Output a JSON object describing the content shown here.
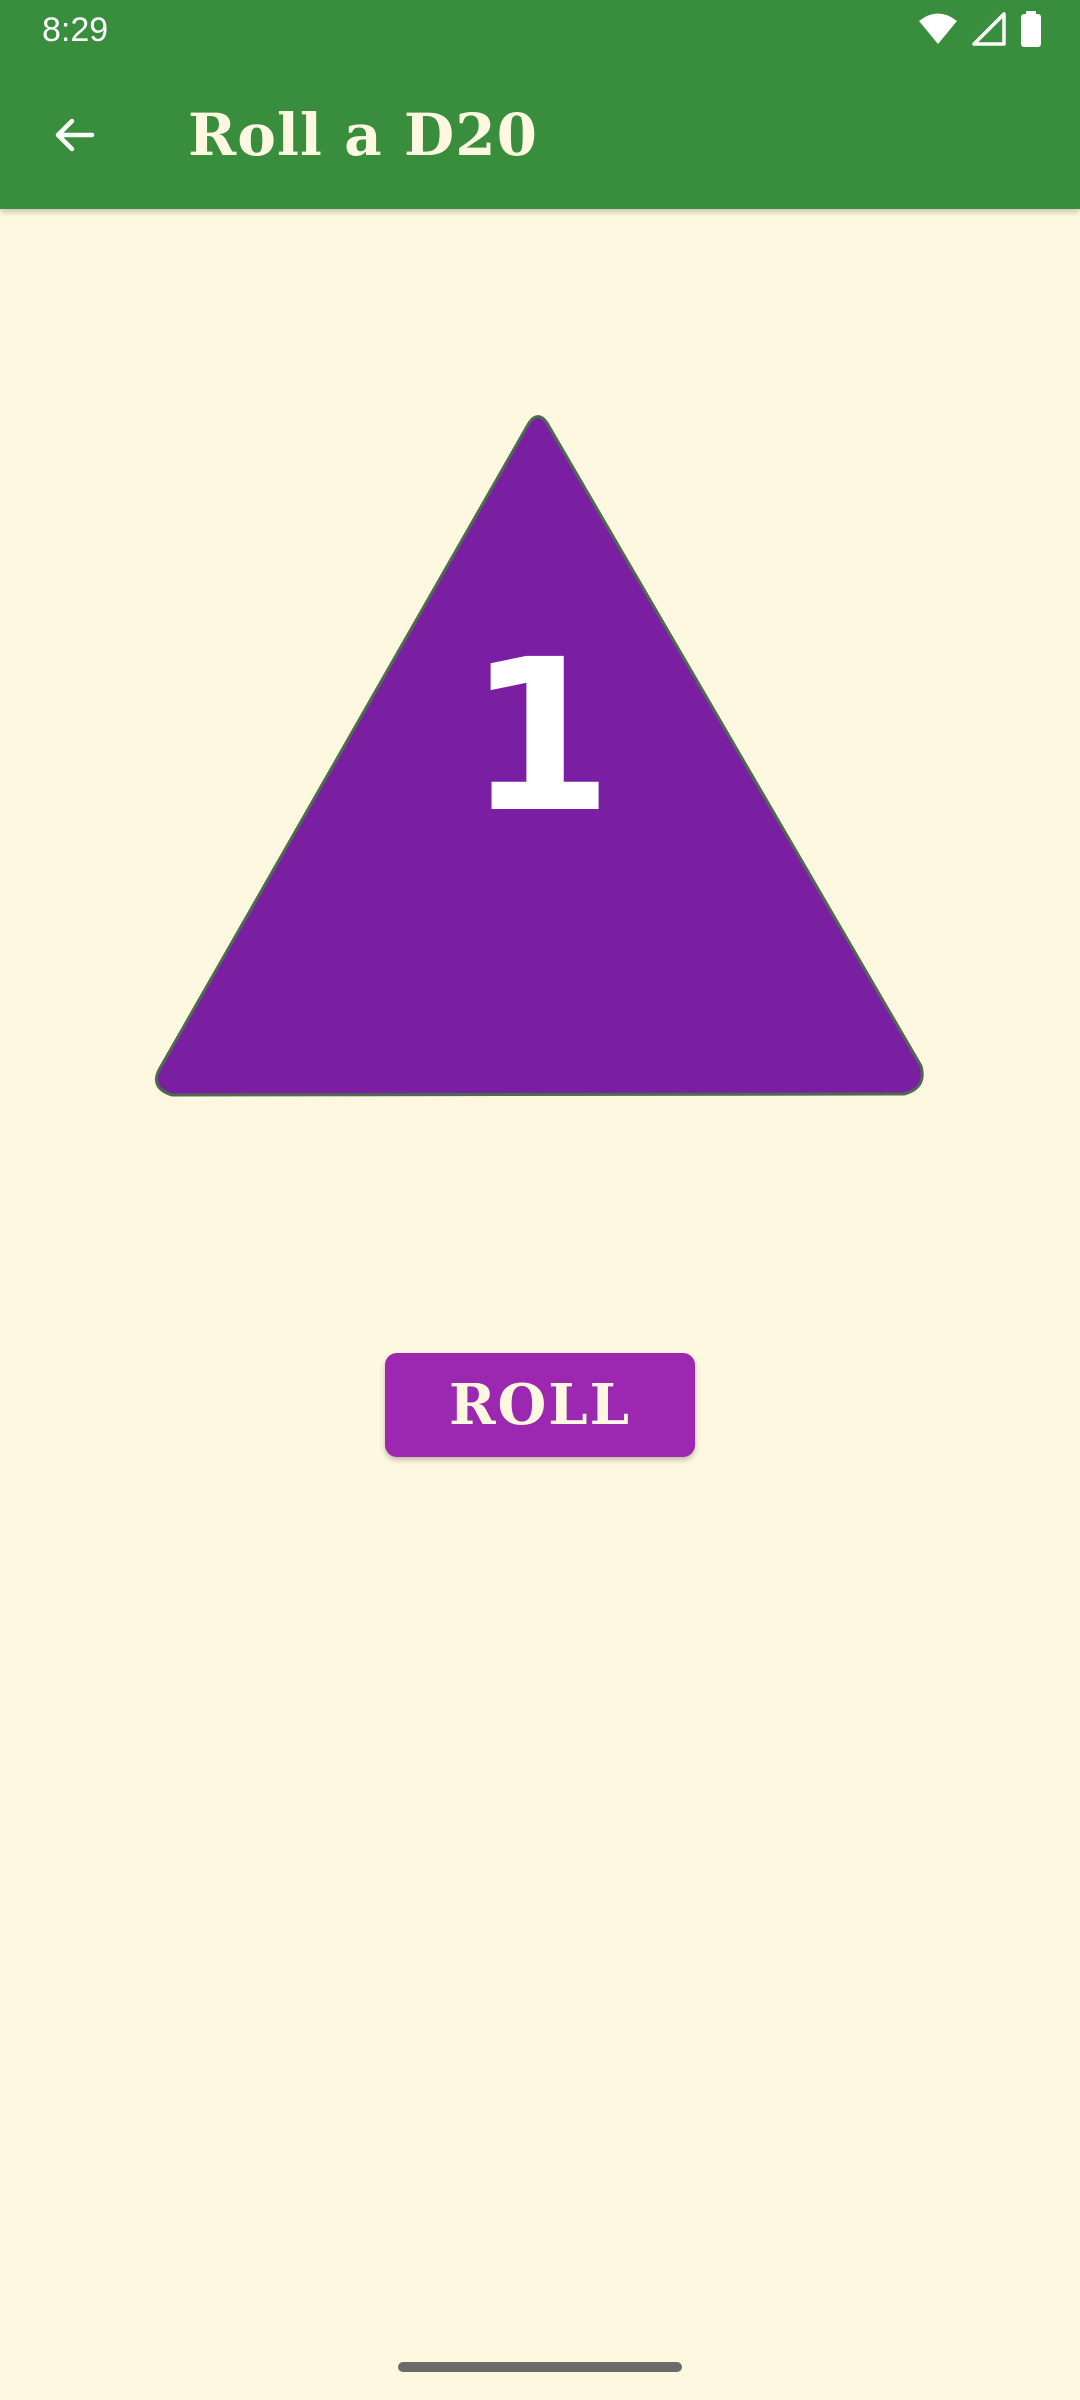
{
  "status_bar": {
    "time": "8:29",
    "icons": [
      "wifi-icon",
      "signal-icon",
      "battery-icon"
    ]
  },
  "app_bar": {
    "title": "Roll a D20",
    "back_icon": "arrow-back-icon",
    "background_color": "#388E3C",
    "title_color": "#FFF8E1"
  },
  "die": {
    "value": "1",
    "shape": "triangle",
    "fill_color": "#7B1FA2"
  },
  "roll_button": {
    "label": "ROLL",
    "color": "#9C27B0"
  },
  "page": {
    "background_color": "#FFF8E1"
  }
}
